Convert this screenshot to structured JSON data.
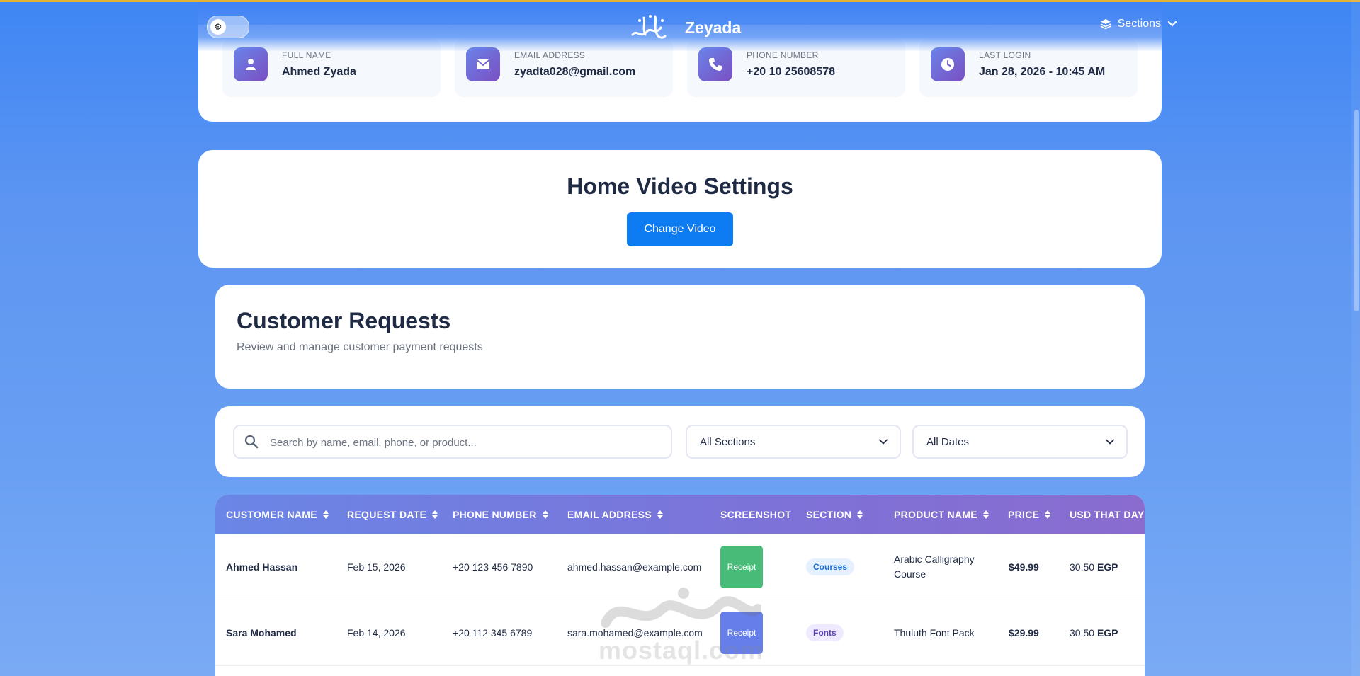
{
  "header": {
    "brand_name": "Zeyada",
    "sections_label": "Sections"
  },
  "profile": {
    "items": [
      {
        "icon": "user-icon",
        "label": "FULL NAME",
        "value": "Ahmed Zyada"
      },
      {
        "icon": "envelope-icon",
        "label": "EMAIL ADDRESS",
        "value": "zyadta028@gmail.com"
      },
      {
        "icon": "phone-icon",
        "label": "PHONE NUMBER",
        "value": "+20 10 25608578"
      },
      {
        "icon": "clock-icon",
        "label": "LAST LOGIN",
        "value": "Jan 28, 2026 - 10:45 AM"
      }
    ]
  },
  "video_settings": {
    "title": "Home Video Settings",
    "button_label": "Change Video"
  },
  "requests": {
    "title": "Customer Requests",
    "subtitle": "Review and manage customer payment requests"
  },
  "filters": {
    "search_placeholder": "Search by name, email, phone, or product...",
    "section_selected": "All Sections",
    "date_selected": "All Dates"
  },
  "table": {
    "headers": [
      "CUSTOMER NAME",
      "REQUEST DATE",
      "PHONE NUMBER",
      "EMAIL ADDRESS",
      "SCREENSHOT",
      "SECTION",
      "PRODUCT NAME",
      "PRICE",
      "USD THAT DAY"
    ],
    "rows": [
      {
        "customer_name": "Ahmed Hassan",
        "request_date": "Feb 15, 2026",
        "phone": "+20 123 456 7890",
        "email": "ahmed.hassan@example.com",
        "screenshot_label": "Receipt",
        "section": "Courses",
        "product_line1": "Arabic Calligraphy",
        "product_line2": "Course",
        "price": "$49.99",
        "usd_value": "30.50",
        "usd_currency": "EGP"
      },
      {
        "customer_name": "Sara Mohamed",
        "request_date": "Feb 14, 2026",
        "phone": "+20 112 345 6789",
        "email": "sara.mohamed@example.com",
        "screenshot_label": "Receipt",
        "section": "Fonts",
        "product_line1": "Thuluth Font Pack",
        "product_line2": "",
        "price": "$29.99",
        "usd_value": "30.50",
        "usd_currency": "EGP"
      }
    ]
  },
  "watermark": {
    "latin": "mostaql.com"
  },
  "colors": {
    "accent": "#0d7bf2",
    "receipt_green": "#48bb78",
    "receipt_blue": "#667eea",
    "header_gradient_start": "#6a86e6",
    "header_gradient_end": "#8a6ccf"
  }
}
